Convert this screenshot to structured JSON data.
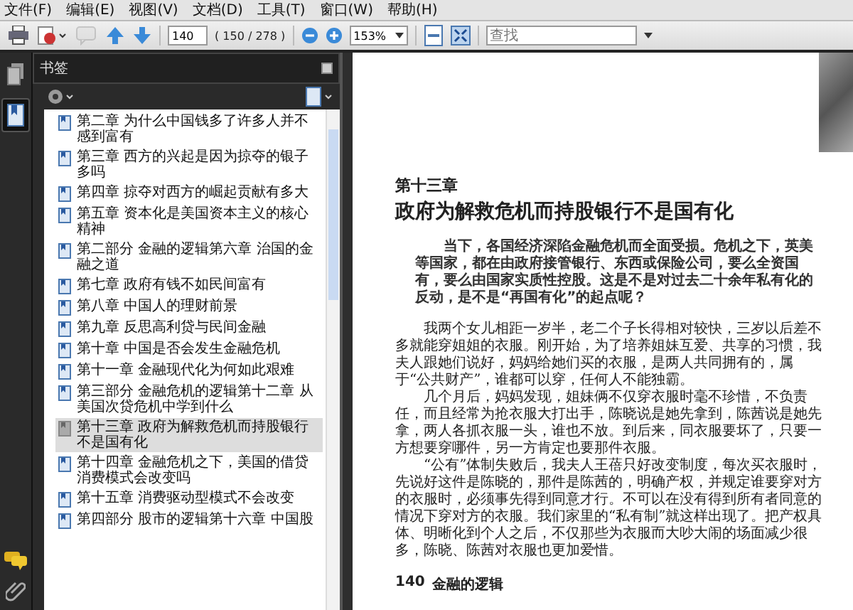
{
  "menu": [
    "文件(F)",
    "编辑(E)",
    "视图(V)",
    "文档(D)",
    "工具(T)",
    "窗口(W)",
    "帮助(H)"
  ],
  "toolbar": {
    "tools": [
      {
        "kind": "print",
        "disabled": false
      },
      {
        "kind": "sign",
        "disabled": false
      },
      {
        "kind": "comment",
        "disabled": true
      },
      {
        "kind": "prev",
        "disabled": false
      },
      {
        "kind": "next",
        "disabled": false
      }
    ],
    "page_input": "140",
    "page_count": "( 150 / 278 )",
    "zoom": "153%",
    "search": {
      "placeholder": "查找"
    }
  },
  "rail": [
    {
      "kind": "pages",
      "selected": false
    },
    {
      "kind": "bookmarks",
      "selected": true
    }
  ],
  "sidebar": {
    "title": "书签",
    "bookmarks": [
      {
        "label": "第二章 为什么中国钱多了许多人并不感到富有",
        "selected": false
      },
      {
        "label": "第三章 西方的兴起是因为掠夺的银子多吗",
        "selected": false
      },
      {
        "label": "第四章 掠夺对西方的崛起贡献有多大",
        "selected": false
      },
      {
        "label": "第五章 资本化是美国资本主义的核心精神",
        "selected": false
      },
      {
        "label": "第二部分 金融的逻辑第六章 治国的金融之道",
        "selected": false
      },
      {
        "label": "第七章 政府有钱不如民间富有",
        "selected": false
      },
      {
        "label": "第八章 中国人的理财前景",
        "selected": false
      },
      {
        "label": "第九章 反思高利贷与民间金融",
        "selected": false
      },
      {
        "label": "第十章 中国是否会发生金融危机",
        "selected": false
      },
      {
        "label": "第十一章 金融现代化为何如此艰难",
        "selected": false
      },
      {
        "label": "第三部分 金融危机的逻辑第十二章 从美国次贷危机中学到什么",
        "selected": false
      },
      {
        "label": "第十三章 政府为解救危机而持股银行不是国有化",
        "selected": true
      },
      {
        "label": "第十四章 金融危机之下，美国的借贷消费模式会改变吗",
        "selected": false
      },
      {
        "label": "第十五章 消费驱动型模式不会改变",
        "selected": false
      },
      {
        "label": "第四部分 股市的逻辑第十六章 中国股",
        "selected": false
      }
    ]
  },
  "page": {
    "chapter": "第十三章",
    "title": "政府为解救危机而持股银行不是国有化",
    "intro": "当下，各国经济深陷金融危机而全面受损。危机之下，英美等国家，都在由政府接管银行、东西或保险公司，要么全资国有，要么由国家实质性控股。这是不是对过去二十余年私有化的反动，是不是“再国有化”的起点呢？",
    "paragraphs": [
      "我两个女儿相距一岁半，老二个子长得相对较快，三岁以后差不多就能穿姐姐的衣服。刚开始，为了培养姐妹互爱、共享的习惯，我夫人跟她们说好，妈妈给她们买的衣服，是两人共同拥有的，属于“公共财产”，谁都可以穿，任何人不能独霸。",
      "几个月后，妈妈发现，姐妹俩不仅穿衣服时毫不珍惜，不负责任，而且经常为抢衣服大打出手，陈晓说是她先拿到，陈茜说是她先拿，两人各抓衣服一头，谁也不放。到后来，同衣服要坏了，只要一方想要穿哪件，另一方肯定也要那件衣服。",
      "“公有”体制失败后，我夫人王蓓只好改变制度，每次买衣服时，先说好这件是陈晓的，那件是陈茜的，明确产权，并规定谁要穿对方的衣服时，必须事先得到同意才行。不可以在没有得到所有者同意的情况下穿对方的衣服。我们家里的“私有制”就这样出现了。把产权具体、明晰化到个人之后，不仅那些为衣服而大吵大闹的场面减少很多，陈晓、陈茜对衣服也更加爱惜。"
    ],
    "footer_number": "140",
    "footer_title": "金融的逻辑"
  }
}
